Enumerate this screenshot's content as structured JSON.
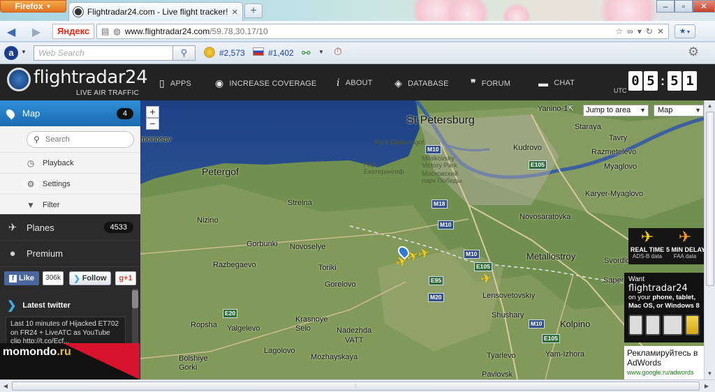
{
  "browser": {
    "app_button": "Firefox",
    "tab_title": "Flightradar24.com - Live flight tracker!",
    "new_tab": "+",
    "url_host": "www.flightradar24.com",
    "url_path": "/59.78,30.17/10",
    "yandex_label": "Яндекс",
    "window_controls": [
      "–",
      "▫",
      "✕"
    ]
  },
  "toolbar": {
    "search_placeholder": "Web Search",
    "rank1": "#2,573",
    "rank2": "#1,402"
  },
  "header": {
    "logo_text": "flightradar24",
    "logo_subtitle": "LIVE AIR TRAFFIC",
    "menu": [
      {
        "label": "APPS",
        "icon": "phone-icon"
      },
      {
        "label": "INCREASE COVERAGE",
        "icon": "eye-icon"
      },
      {
        "label": "ABOUT",
        "icon": "info-icon"
      },
      {
        "label": "DATABASE",
        "icon": "database-icon"
      },
      {
        "label": "FORUM",
        "icon": "quote-icon"
      },
      {
        "label": "CHAT",
        "icon": "chat-icon"
      }
    ],
    "utc_label": "UTC",
    "clock_digits": [
      "0",
      "5",
      "5",
      "1"
    ]
  },
  "sidebar": {
    "map_label": "Map",
    "map_count": "4",
    "search_placeholder": "Search",
    "sub_items": [
      "Playback",
      "Settings",
      "Filter"
    ],
    "planes_label": "Planes",
    "planes_count": "4533",
    "premium_label": "Premium",
    "like_label": "Like",
    "like_count": "306k",
    "follow_label": "Follow",
    "gplus_label": "g+1",
    "twitter_heading": "Latest twitter",
    "tweet_text": "Last 10 minutes of Hijacked ET702 on FR24 + LiveATC as YouTube clip http://t.co/Ecf...",
    "ad_brand": "momondo",
    "ad_tld": ".ru"
  },
  "map": {
    "zoom_in": "+",
    "zoom_out": "−",
    "jump_label": "Jump to area",
    "map_type": "Map",
    "labels": [
      {
        "text": "St Petersburg",
        "cls": "big"
      },
      {
        "text": "Petergof",
        "cls": "city"
      },
      {
        "text": "Strelna",
        "cls": ""
      },
      {
        "text": "Nizino",
        "cls": ""
      },
      {
        "text": "Gorbunki",
        "cls": ""
      },
      {
        "text": "Novoselye",
        "cls": ""
      },
      {
        "text": "Razbegaevo",
        "cls": ""
      },
      {
        "text": "Toriki",
        "cls": ""
      },
      {
        "text": "Gorelovo",
        "cls": ""
      },
      {
        "text": "Ropsha",
        "cls": ""
      },
      {
        "text": "Yalgelevo",
        "cls": ""
      },
      {
        "text": "Krasnoye Selo",
        "cls": ""
      },
      {
        "text": "Nadezhda",
        "cls": ""
      },
      {
        "text": "VATT",
        "cls": ""
      },
      {
        "text": "Lagolovo",
        "cls": ""
      },
      {
        "text": "Mozhayskaya",
        "cls": ""
      },
      {
        "text": "Bolshiye Gorki",
        "cls": ""
      },
      {
        "text": "Kudrovo",
        "cls": ""
      },
      {
        "text": "Staraya",
        "cls": ""
      },
      {
        "text": "Tavry",
        "cls": ""
      },
      {
        "text": "Razmetelevo",
        "cls": ""
      },
      {
        "text": "Myaglovo",
        "cls": ""
      },
      {
        "text": "Karyer-Myaglovo",
        "cls": ""
      },
      {
        "text": "Novosaratovka",
        "cls": ""
      },
      {
        "text": "Metallostroy",
        "cls": ""
      },
      {
        "text": "Svordlova",
        "cls": ""
      },
      {
        "text": "Saper",
        "cls": ""
      },
      {
        "text": "Lensovetovskiy",
        "cls": ""
      },
      {
        "text": "Shushary",
        "cls": ""
      },
      {
        "text": "Kolpino",
        "cls": "city"
      },
      {
        "text": "Yam-Izhora",
        "cls": ""
      },
      {
        "text": "Tyarlevo",
        "cls": ""
      },
      {
        "text": "Pavlovsk",
        "cls": ""
      },
      {
        "text": "Yanino-1",
        "cls": ""
      },
      {
        "text": "monosov",
        "cls": ""
      }
    ],
    "district_labels": [
      "Park Ekateringof",
      "Парк Екатерингоф",
      "Moskovsky Victory Park",
      "Московский парк Победы"
    ],
    "roads": [
      "M10",
      "E105",
      "M18",
      "M10",
      "E105",
      "E95",
      "M20",
      "M10",
      "E20",
      "E105",
      "M10"
    ],
    "ad_realtime_title": "REAL TIME",
    "ad_realtime_sub": "ADS-B data",
    "ad_delay_title": "5 MIN DELAY",
    "ad_delay_sub": "FAA data",
    "ad_want_prefix": "Want",
    "ad_want_brand": "flightradar24",
    "ad_want_line1": "on your",
    "ad_want_line1_bold": "phone, tablet,",
    "ad_want_line2": "Mac OS, or Windows 8",
    "ad_google_title": "Рекламируйтесь в AdWords",
    "ad_google_url": "www.google.ru/adwords"
  },
  "colors": {
    "brand_blue": "#1c6bb1",
    "header_bg": "#232323",
    "plane_yellow": "#f0cc1c"
  }
}
